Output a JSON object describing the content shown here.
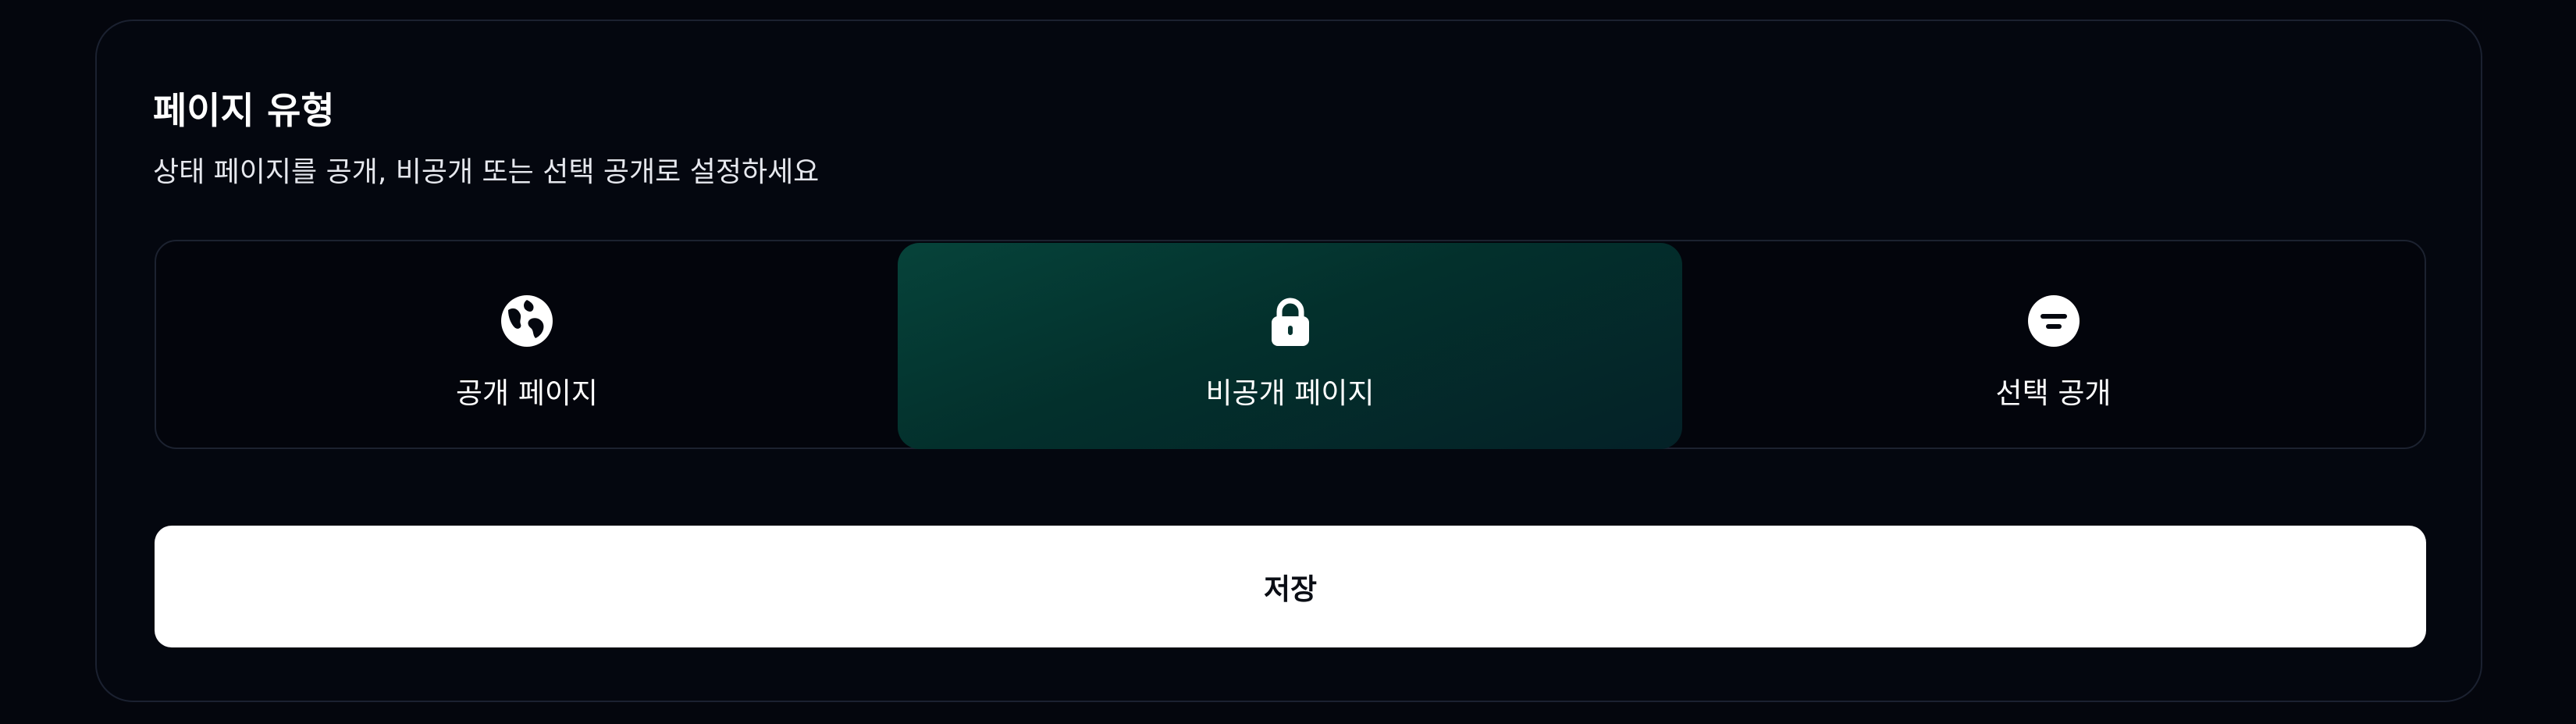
{
  "section": {
    "title": "페이지 유형",
    "subtitle": "상태 페이지를 공개, 비공개 또는 선택 공개로 설정하세요"
  },
  "page_type": {
    "selected": "private",
    "options": [
      {
        "id": "public",
        "label": "공개 페이지",
        "icon": "globe-icon"
      },
      {
        "id": "private",
        "label": "비공개 페이지",
        "icon": "lock-icon"
      },
      {
        "id": "selective",
        "label": "선택 공개",
        "icon": "filter-icon"
      }
    ]
  },
  "actions": {
    "save_label": "저장"
  },
  "colors": {
    "background": "#04060d",
    "card_border": "#1b2130",
    "selected_option": "#063b35",
    "save_button": "#ffffff"
  }
}
